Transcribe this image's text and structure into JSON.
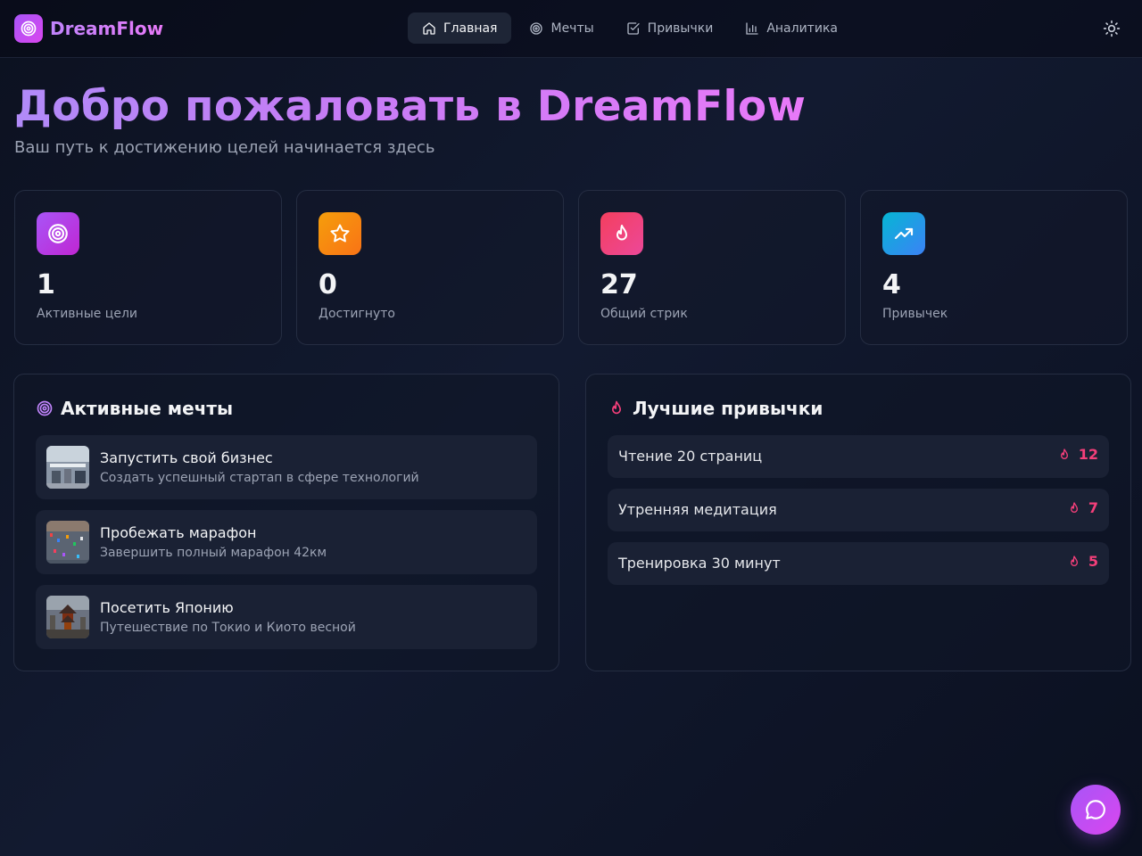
{
  "app": {
    "name": "DreamFlow"
  },
  "nav": {
    "items": [
      {
        "label": "Главная",
        "icon": "home-icon",
        "active": true
      },
      {
        "label": "Мечты",
        "icon": "target-icon",
        "active": false
      },
      {
        "label": "Привычки",
        "icon": "checkbox-icon",
        "active": false
      },
      {
        "label": "Аналитика",
        "icon": "bar-chart-icon",
        "active": false
      }
    ],
    "theme_icon": "sun-icon"
  },
  "hero": {
    "title": "Добро пожаловать в DreamFlow",
    "subtitle": "Ваш путь к достижению целей начинается здесь"
  },
  "stats": [
    {
      "value": "1",
      "label": "Активные цели",
      "icon": "target-icon",
      "color": "#a855f7"
    },
    {
      "value": "0",
      "label": "Достигнуто",
      "icon": "star-icon",
      "color": "#f97316"
    },
    {
      "value": "27",
      "label": "Общий стрик",
      "icon": "flame-icon",
      "color": "#ec4899"
    },
    {
      "value": "4",
      "label": "Привычек",
      "icon": "trending-up-icon",
      "color": "#0ea5e9"
    }
  ],
  "dreams_panel": {
    "title": "Активные мечты",
    "items": [
      {
        "title": "Запустить свой бизнес",
        "description": "Создать успешный стартап в сфере технологий"
      },
      {
        "title": "Пробежать марафон",
        "description": "Завершить полный марафон 42км"
      },
      {
        "title": "Посетить Японию",
        "description": "Путешествие по Токио и Киото весной"
      }
    ]
  },
  "habits_panel": {
    "title": "Лучшие привычки",
    "items": [
      {
        "name": "Чтение 20 страниц",
        "streak": "12"
      },
      {
        "name": "Утренняя медитация",
        "streak": "7"
      },
      {
        "name": "Тренировка 30 минут",
        "streak": "5"
      }
    ]
  },
  "colors": {
    "accent": "#a855f7",
    "accent2": "#d946ef",
    "streak": "#f43f7a"
  },
  "chat": {
    "icon": "chat-bubble-icon"
  }
}
